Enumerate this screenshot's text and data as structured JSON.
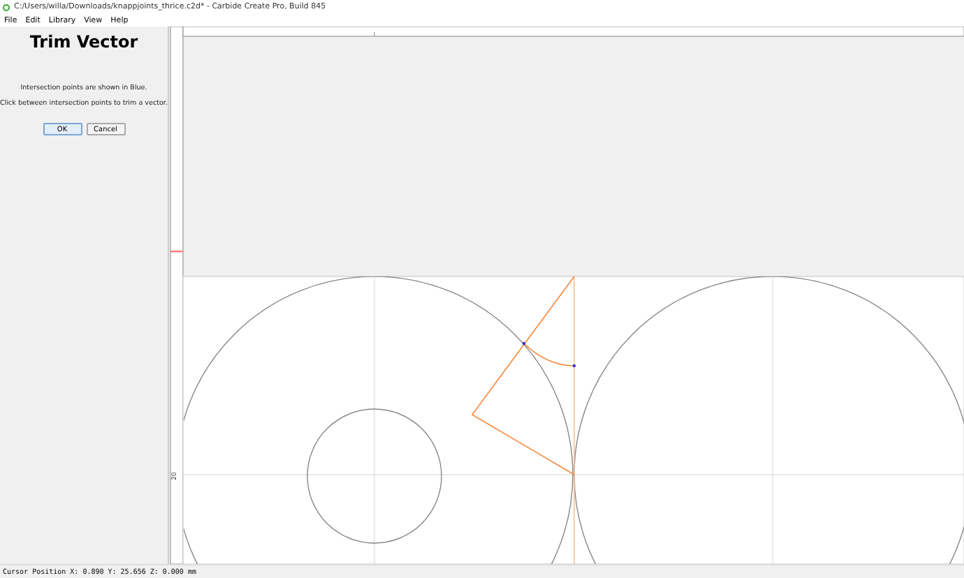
{
  "window": {
    "title": "C:/Users/willa/Downloads/knappjoints_thrice.c2d* - Carbide Create Pro, Build 845"
  },
  "menu": [
    "File",
    "Edit",
    "Library",
    "View",
    "Help"
  ],
  "panel": {
    "heading": "Trim Vector",
    "messages": [
      "Intersection points are shown in Blue.",
      "Click between intersection points to trim a vector."
    ],
    "buttons": [
      {
        "label": "OK",
        "selected": true
      },
      {
        "label": "Cancel",
        "selected": false
      }
    ]
  },
  "ruler": {
    "label": "20"
  },
  "status_bar": "Cursor Position X: 0.890 Y: 25.656 Z: 0.000 mm"
}
